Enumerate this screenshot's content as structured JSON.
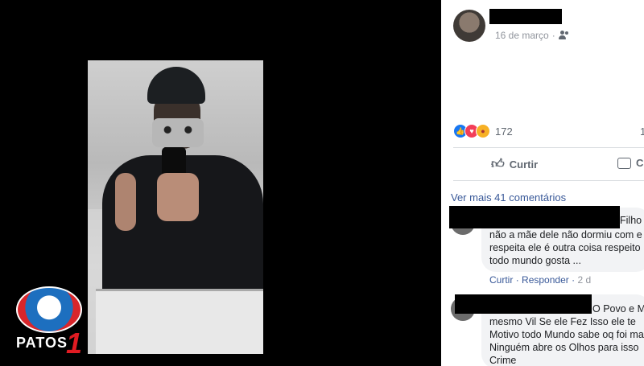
{
  "watermark": {
    "text": "PATOS",
    "number": "1"
  },
  "post": {
    "date": "16 de março",
    "privacy_icon": "friends-icon",
    "reactions": [
      "like",
      "love",
      "angry"
    ],
    "reaction_count": "172",
    "right_count": "1",
    "actions": {
      "like": "Curtir",
      "comment": "C"
    },
    "see_more": "Ver mais 41 comentários"
  },
  "comments": [
    {
      "lines": [
        "Filho",
        "não a mãe dele não dormiu com e",
        "respeita ele é outra coisa respeito",
        "todo mundo gosta ..."
      ],
      "actions": {
        "like": "Curtir",
        "reply": "Responder",
        "time": "2 d"
      }
    },
    {
      "lines": [
        "O Povo e M",
        "mesmo Vil Se ele Fez Isso ele te",
        "Motivo todo Mundo sabe oq foi ma",
        "Ninguém abre os Olhos para isso",
        "Crime"
      ]
    }
  ],
  "colors": {
    "link": "#385898",
    "like_blue": "#1877f2",
    "logo_red": "#e01b22",
    "logo_blue": "#1d6fbf"
  }
}
